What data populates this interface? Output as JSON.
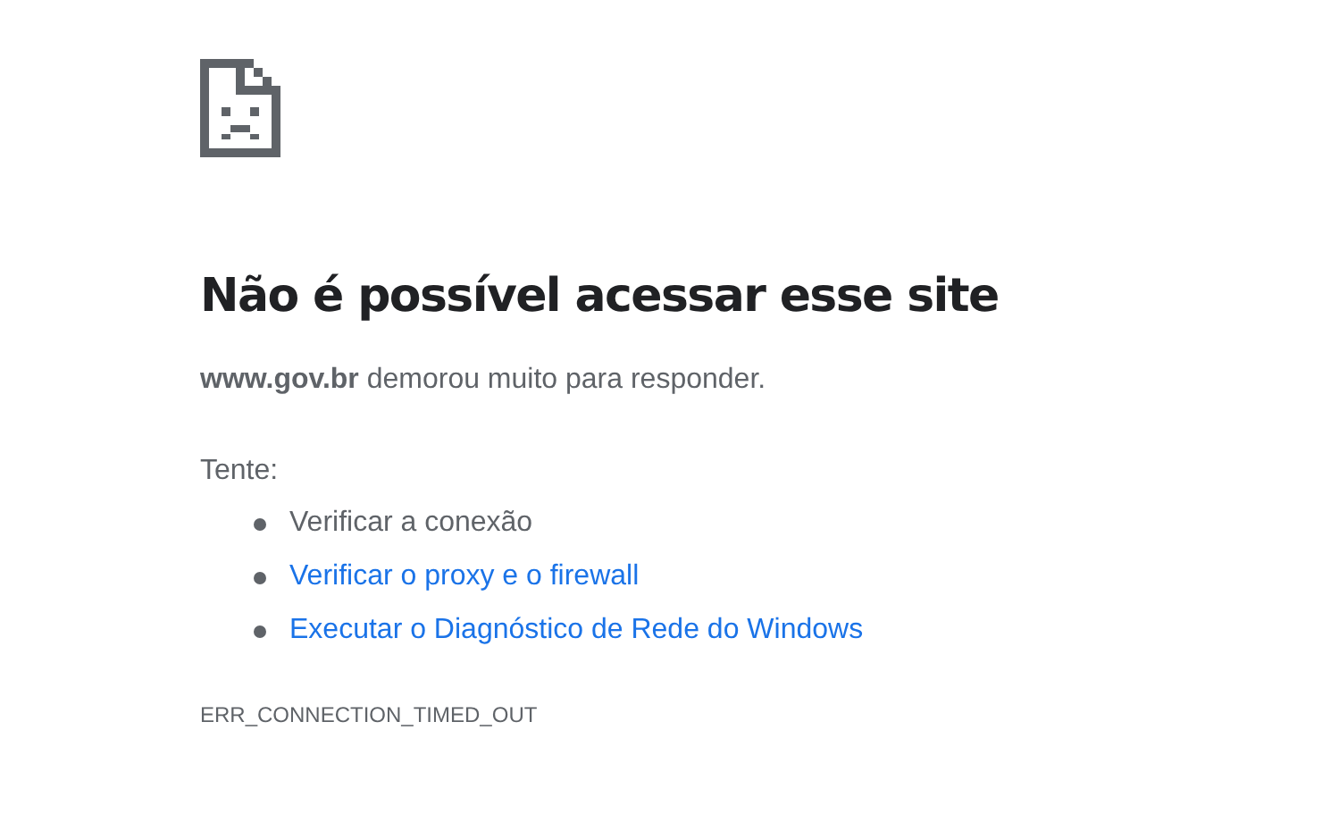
{
  "title": "Não é possível acessar esse site",
  "summary": "**www.gov.br** demorou muito para responder.",
  "suggestions_heading": "Tente:",
  "suggestions": [
    {
      "kind": "text",
      "label": "Verificar a conexão"
    },
    {
      "kind": "link",
      "label": "Verificar o proxy e o firewall"
    },
    {
      "kind": "link",
      "label": "Executar o Diagnóstico de Rede do Windows"
    }
  ],
  "error_code": "ERR_CONNECTION_TIMED_OUT"
}
